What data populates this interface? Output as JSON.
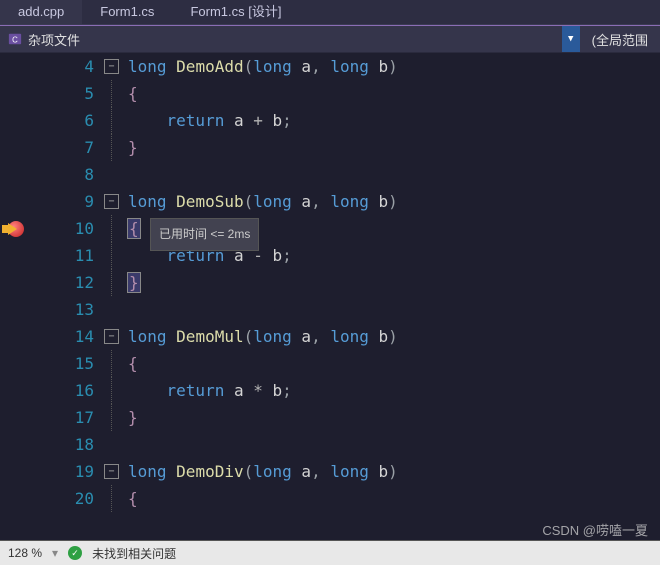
{
  "tabs": [
    {
      "label": "add.cpp",
      "active": true
    },
    {
      "label": "Form1.cs",
      "active": false
    },
    {
      "label": "Form1.cs [设计]",
      "active": false
    }
  ],
  "toolbar": {
    "project": "杂项文件",
    "scope": "(全局范围"
  },
  "editor": {
    "line_start": 4,
    "line_end": 20,
    "breakpoint_line": 10,
    "current_line": 10,
    "tooltip": "已用时间 <= 2ms",
    "lines": [
      {
        "n": 4,
        "fold": "start",
        "tokens": [
          [
            "kw",
            "long "
          ],
          [
            "fn",
            "DemoAdd"
          ],
          [
            "pn",
            "("
          ],
          [
            "kw",
            "long "
          ],
          [
            "tx",
            "a"
          ],
          [
            "pn",
            ", "
          ],
          [
            "kw",
            "long "
          ],
          [
            "tx",
            "b"
          ],
          [
            "pn",
            ")"
          ]
        ]
      },
      {
        "n": 5,
        "fold": "mid",
        "tokens": [
          [
            "br",
            "{"
          ]
        ]
      },
      {
        "n": 6,
        "fold": "mid",
        "tokens": [
          [
            "tx",
            "    "
          ],
          [
            "kw",
            "return "
          ],
          [
            "tx",
            "a "
          ],
          [
            "op",
            "+"
          ],
          [
            "tx",
            " b"
          ],
          [
            "pn",
            ";"
          ]
        ]
      },
      {
        "n": 7,
        "fold": "mid",
        "tokens": [
          [
            "br",
            "}"
          ]
        ]
      },
      {
        "n": 8,
        "fold": "",
        "tokens": []
      },
      {
        "n": 9,
        "fold": "start",
        "tokens": [
          [
            "kw",
            "long "
          ],
          [
            "fn",
            "DemoSub"
          ],
          [
            "pn",
            "("
          ],
          [
            "kw",
            "long "
          ],
          [
            "tx",
            "a"
          ],
          [
            "pn",
            ", "
          ],
          [
            "kw",
            "long "
          ],
          [
            "tx",
            "b"
          ],
          [
            "pn",
            ")"
          ]
        ]
      },
      {
        "n": 10,
        "fold": "mid",
        "hl": true,
        "tokens": [
          [
            "br",
            "{"
          ]
        ]
      },
      {
        "n": 11,
        "fold": "mid",
        "tokens": [
          [
            "tx",
            "    "
          ],
          [
            "kw",
            "return "
          ],
          [
            "tx",
            "a "
          ],
          [
            "op",
            "-"
          ],
          [
            "tx",
            " b"
          ],
          [
            "pn",
            ";"
          ]
        ]
      },
      {
        "n": 12,
        "fold": "mid",
        "tokens": [
          [
            "br",
            "}"
          ]
        ],
        "hlbrace": true
      },
      {
        "n": 13,
        "fold": "",
        "tokens": []
      },
      {
        "n": 14,
        "fold": "start",
        "tokens": [
          [
            "kw",
            "long "
          ],
          [
            "fn",
            "DemoMul"
          ],
          [
            "pn",
            "("
          ],
          [
            "kw",
            "long "
          ],
          [
            "tx",
            "a"
          ],
          [
            "pn",
            ", "
          ],
          [
            "kw",
            "long "
          ],
          [
            "tx",
            "b"
          ],
          [
            "pn",
            ")"
          ]
        ]
      },
      {
        "n": 15,
        "fold": "mid",
        "tokens": [
          [
            "br",
            "{"
          ]
        ]
      },
      {
        "n": 16,
        "fold": "mid",
        "tokens": [
          [
            "tx",
            "    "
          ],
          [
            "kw",
            "return "
          ],
          [
            "tx",
            "a "
          ],
          [
            "op",
            "*"
          ],
          [
            "tx",
            " b"
          ],
          [
            "pn",
            ";"
          ]
        ]
      },
      {
        "n": 17,
        "fold": "mid",
        "tokens": [
          [
            "br",
            "}"
          ]
        ]
      },
      {
        "n": 18,
        "fold": "",
        "tokens": []
      },
      {
        "n": 19,
        "fold": "start",
        "tokens": [
          [
            "kw",
            "long "
          ],
          [
            "fn",
            "DemoDiv"
          ],
          [
            "pn",
            "("
          ],
          [
            "kw",
            "long "
          ],
          [
            "tx",
            "a"
          ],
          [
            "pn",
            ", "
          ],
          [
            "kw",
            "long "
          ],
          [
            "tx",
            "b"
          ],
          [
            "pn",
            ")"
          ]
        ]
      },
      {
        "n": 20,
        "fold": "mid",
        "tokens": [
          [
            "br",
            "{"
          ]
        ]
      }
    ]
  },
  "status": {
    "zoom": "128 %",
    "issues": "未找到相关问题"
  },
  "watermark": "CSDN @唠嗑一夏"
}
